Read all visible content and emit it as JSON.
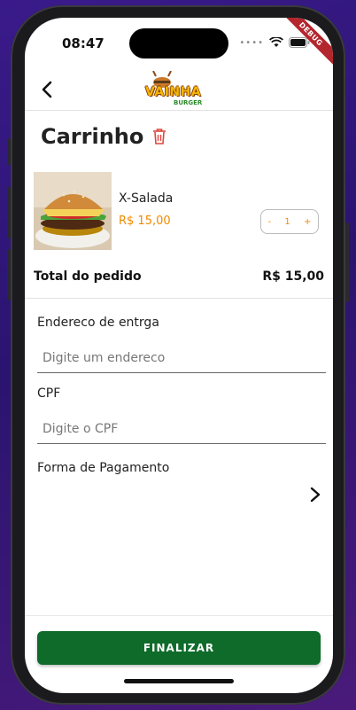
{
  "status_bar": {
    "time": "08:47",
    "debug_label": "DEBUG"
  },
  "app_bar": {
    "logo_text": "VAINHA",
    "logo_sub": "BURGER"
  },
  "cart": {
    "title": "Carrinho",
    "items": [
      {
        "name": "X-Salada",
        "price": "R$ 15,00",
        "quantity": "1",
        "minus": "-",
        "plus": "+"
      }
    ],
    "total_label": "Total do pedido",
    "total_value": "R$ 15,00"
  },
  "form": {
    "address_label": "Endereco de entrga",
    "address_placeholder": "Digite um endereco",
    "cpf_label": "CPF",
    "cpf_placeholder": "Digite o CPF",
    "payment_label": "Forma de Pagamento"
  },
  "actions": {
    "finalize_label": "FINALIZAR"
  },
  "colors": {
    "accent": "#f08a00",
    "primary_button": "#0e6b2a",
    "trash": "#e0453a"
  }
}
